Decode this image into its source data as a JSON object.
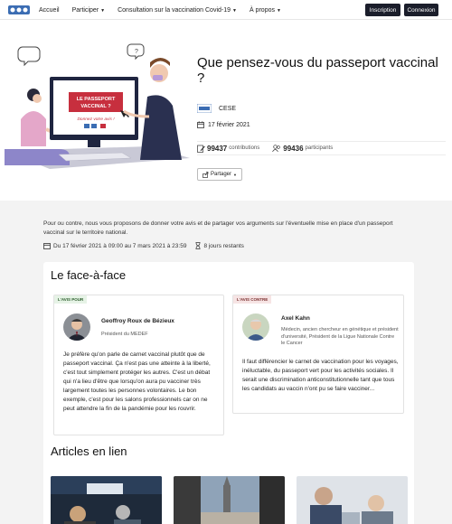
{
  "nav": {
    "items": [
      {
        "label": "Accueil",
        "caret": false
      },
      {
        "label": "Participer",
        "caret": true
      },
      {
        "label": "Consultation sur la vaccination Covid-19",
        "caret": true
      },
      {
        "label": "À propos",
        "caret": true
      }
    ],
    "inscription": "Inscription",
    "connexion": "Connexion"
  },
  "hero": {
    "title": "Que pensez-vous du passeport vaccinal ?",
    "illustration": {
      "screen_title": "LE PASSEPORT VACCINAL ?",
      "screen_cta": "Donnez votre avis !"
    },
    "author": "CESE",
    "date": "17 février 2021",
    "contributions_count": "99437",
    "contributions_label": "contributions",
    "participants_count": "99436",
    "participants_label": "participants",
    "share_label": "Partager"
  },
  "intro": {
    "text": "Pour ou contre, nous vous proposons de donner votre avis et de partager vos arguments sur l'éventuelle mise en place d'un passeport vaccinal sur le territoire national.",
    "period": "Du 17 février 2021 à 09:00 au 7 mars 2021 à 23:59",
    "remaining": "8 jours restants"
  },
  "faceaface": {
    "title": "Le face-à-face",
    "pour": {
      "badge": "L'AVIS POUR",
      "name": "Geoffroy Roux de Bézieux",
      "role": "Président du MEDEF",
      "text": "Je préfère qu'on parle de carnet vaccinal plutôt que de passeport vaccinal. Ça n'est pas une atteinte à la liberté, c'est tout simplement protéger les autres. C'est un débat qui n'a lieu d'être que lorsqu'on aura pu vacciner très largement toutes les personnes volontaires. Le bon exemple, c'est pour les salons professionnels car on ne peut attendre la fin de la pandémie pour les rouvrir."
    },
    "contre": {
      "badge": "L'AVIS CONTRE",
      "name": "Axel Kahn",
      "role": "Médecin, ancien chercheur en génétique et président d'université, Président de la Ligue Nationale Contre le Cancer",
      "text": "Il faut différencier le carnet de vaccination pour les voyages, inéluctable, du passeport vert pour les activités sociales. Il serait une discrimination anticonstitutionnelle tant que tous les candidats au vaccin n'ont pu se faire vacciner..."
    }
  },
  "articles": {
    "title": "Articles en lien"
  },
  "icons": {
    "calendar": "calendar-icon",
    "contributions": "edit-icon",
    "participants": "users-icon",
    "share": "share-icon",
    "hourglass": "hourglass-icon"
  },
  "colors": {
    "dark_button": "#1b1e2b",
    "pour_bg": "#e6f3e6",
    "contre_bg": "#f6e4e4",
    "grey_bg": "#f3f3f3"
  }
}
